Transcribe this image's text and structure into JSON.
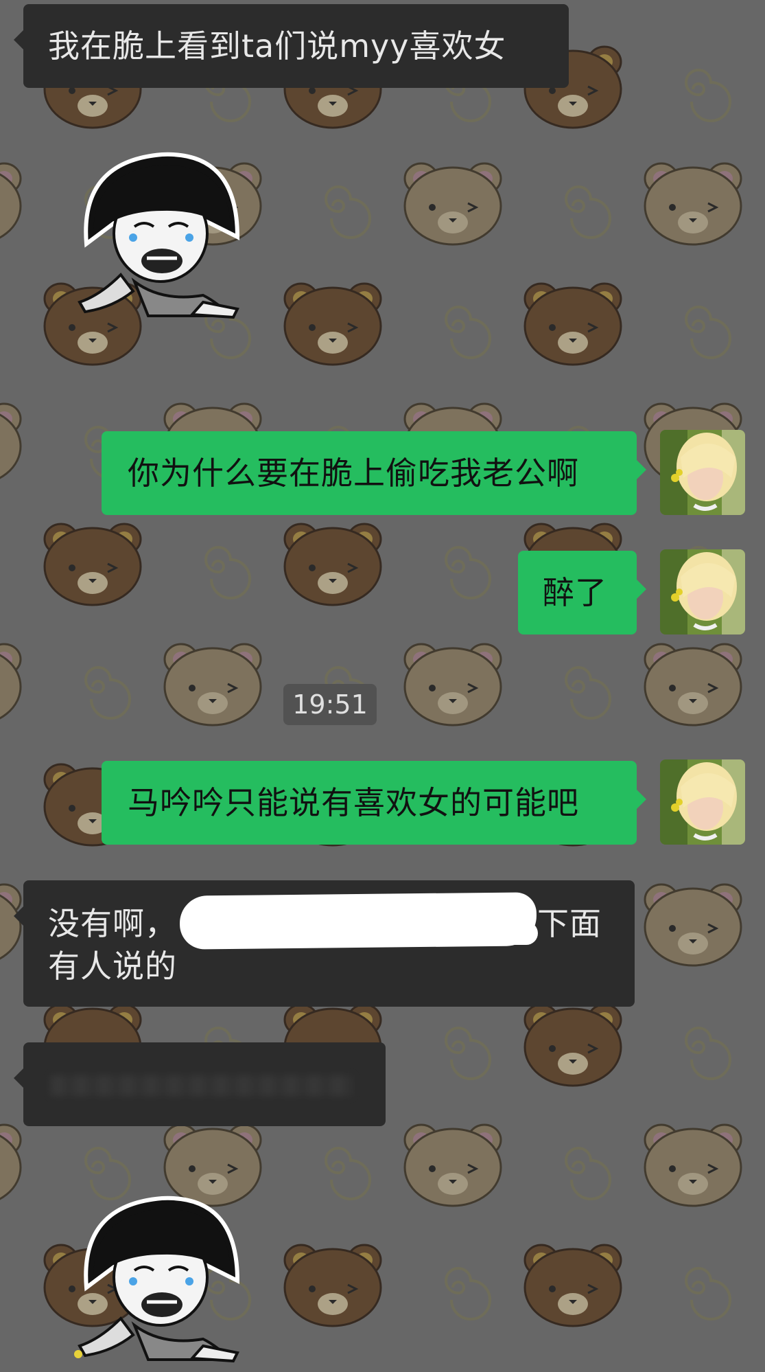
{
  "colors": {
    "background": "#6b6b6b",
    "incoming_bubble": "#2c2c2c",
    "outgoing_bubble": "#25bd5f",
    "timestamp_bg": "#525252"
  },
  "messages": [
    {
      "direction": "incoming",
      "text": "我在脆上看到ta们说myy喜欢女"
    },
    {
      "direction": "incoming",
      "type": "sticker",
      "icon": "crying-mushroom-head-sticker"
    },
    {
      "direction": "outgoing",
      "text": "你为什么要在脆上偷吃我老公啊"
    },
    {
      "direction": "outgoing",
      "text": "醉了"
    },
    {
      "direction": "outgoing",
      "text": "马吟吟只能说有喜欢女的可能吧"
    },
    {
      "direction": "incoming",
      "text_line1_start": "没有啊，",
      "text_line1_end": "頻下面",
      "text_line2": "有人说的",
      "redacted": true
    },
    {
      "direction": "incoming",
      "type": "blurred",
      "text": ""
    },
    {
      "direction": "incoming",
      "type": "sticker",
      "icon": "crying-mushroom-head-sticker"
    }
  ],
  "timestamp": "19:51",
  "wallpaper": {
    "pattern": "bear-heads-and-swirls"
  }
}
